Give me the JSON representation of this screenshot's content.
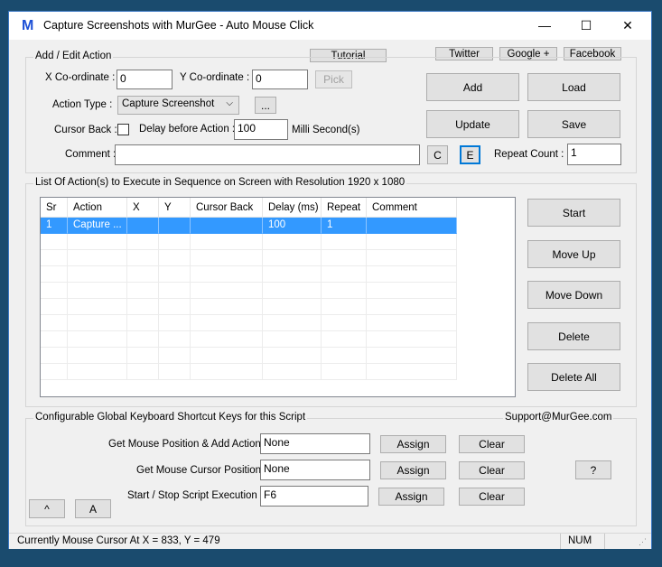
{
  "window": {
    "icon_letter": "M",
    "title": "Capture Screenshots with MurGee - Auto Mouse Click",
    "minimize": "—",
    "maximize": "☐",
    "close": "✕"
  },
  "top_links": {
    "tutorial": "Tutorial",
    "twitter": "Twitter",
    "google": "Google +",
    "facebook": "Facebook"
  },
  "edit": {
    "group_label": "Add / Edit Action",
    "x_label": "X Co-ordinate :",
    "x_value": "0",
    "y_label": "Y Co-ordinate :",
    "y_value": "0",
    "pick": "Pick",
    "action_type_label": "Action Type :",
    "action_type_value": "Capture Screenshot",
    "more": "...",
    "cursor_back_label": "Cursor Back :",
    "cursor_back_checked": false,
    "delay_label": "Delay before Action :",
    "delay_value": "100",
    "delay_unit": "Milli Second(s)",
    "comment_label": "Comment :",
    "comment_value": "",
    "c_button": "C",
    "e_button": "E",
    "repeat_label": "Repeat Count :",
    "repeat_value": "1",
    "add": "Add",
    "load": "Load",
    "update": "Update",
    "save": "Save"
  },
  "list": {
    "group_label": "List Of Action(s) to Execute in Sequence on Screen with Resolution 1920 x 1080",
    "columns": [
      "Sr",
      "Action",
      "X",
      "Y",
      "Cursor Back",
      "Delay (ms)",
      "Repeat",
      "Comment"
    ],
    "rows": [
      [
        "1",
        "Capture ...",
        "",
        "",
        "",
        "100",
        "1",
        ""
      ]
    ],
    "start": "Start",
    "move_up": "Move Up",
    "move_down": "Move Down",
    "delete": "Delete",
    "delete_all": "Delete All"
  },
  "shortcuts": {
    "group_label": "Configurable Global Keyboard Shortcut Keys for this Script",
    "support": "Support@MurGee.com",
    "items": [
      {
        "label": "Get Mouse Position & Add Action :",
        "value": "None",
        "assign": "Assign",
        "clear": "Clear"
      },
      {
        "label": "Get Mouse Cursor Position :",
        "value": "None",
        "assign": "Assign",
        "clear": "Clear"
      },
      {
        "label": "Start / Stop Script Execution :",
        "value": "F6",
        "assign": "Assign",
        "clear": "Clear"
      }
    ],
    "help": "?",
    "caret": "^",
    "a": "A"
  },
  "status": {
    "text": "Currently Mouse Cursor At X = 833, Y = 479",
    "num": "NUM"
  }
}
